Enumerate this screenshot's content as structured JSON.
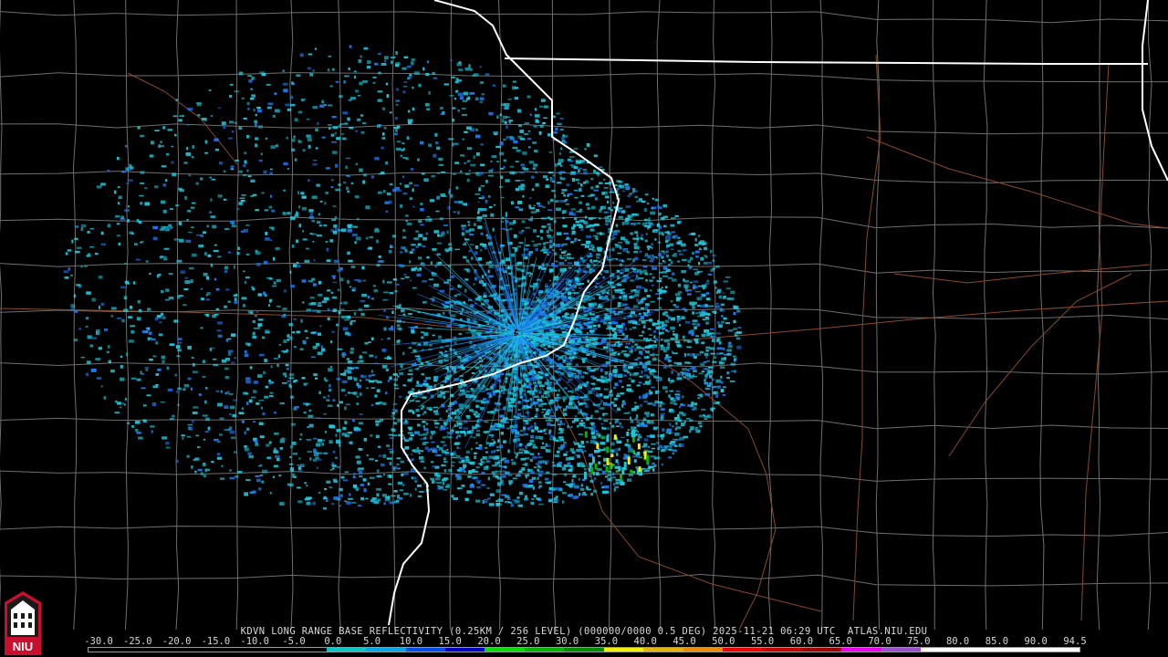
{
  "product": {
    "title": "KDVN LONG RANGE BASE REFLECTIVITY (0.25KM / 256 LEVEL) (000000/0000 0.5 DEG) 2025-11-21 06:29 UTC  ATLAS.NIU.EDU"
  },
  "colorbar": {
    "ticks": [
      "-30.0",
      "-25.0",
      "-20.0",
      "-15.0",
      "-10.0",
      "-5.0",
      "0.0",
      "5.0",
      "10.0",
      "15.0",
      "20.0",
      "25.0",
      "30.0",
      "35.0",
      "40.0",
      "45.0",
      "50.0",
      "55.0",
      "60.0",
      "65.0",
      "70.0",
      "75.0",
      "80.0",
      "85.0",
      "90.0",
      "94.5"
    ],
    "colors": [
      "#000000",
      "#000000",
      "#000000",
      "#000000",
      "#000000",
      "#000000",
      "#00c8c8",
      "#00a8e8",
      "#0050f0",
      "#0000c8",
      "#00e000",
      "#00b400",
      "#008c00",
      "#f0f000",
      "#e6b400",
      "#f08c00",
      "#f00000",
      "#c80000",
      "#a00000",
      "#f000f0",
      "#9a50d0",
      "#ffffff",
      "#ffffff",
      "#ffffff",
      "#ffffff"
    ]
  },
  "logo": {
    "text": "NIU",
    "colors": {
      "red": "#c8102e",
      "white": "#ffffff"
    }
  },
  "map": {
    "colors": {
      "background": "#000000",
      "county_lines": "#6e6e6e",
      "highways": "#8a4a2a",
      "state_lines": "#ffffff",
      "echo_light": "#1ec8dc",
      "echo_mid": "#1e78f0",
      "echo_high": "#00b400",
      "echo_peak": "#f0f000"
    },
    "radar_site": "KDVN"
  }
}
